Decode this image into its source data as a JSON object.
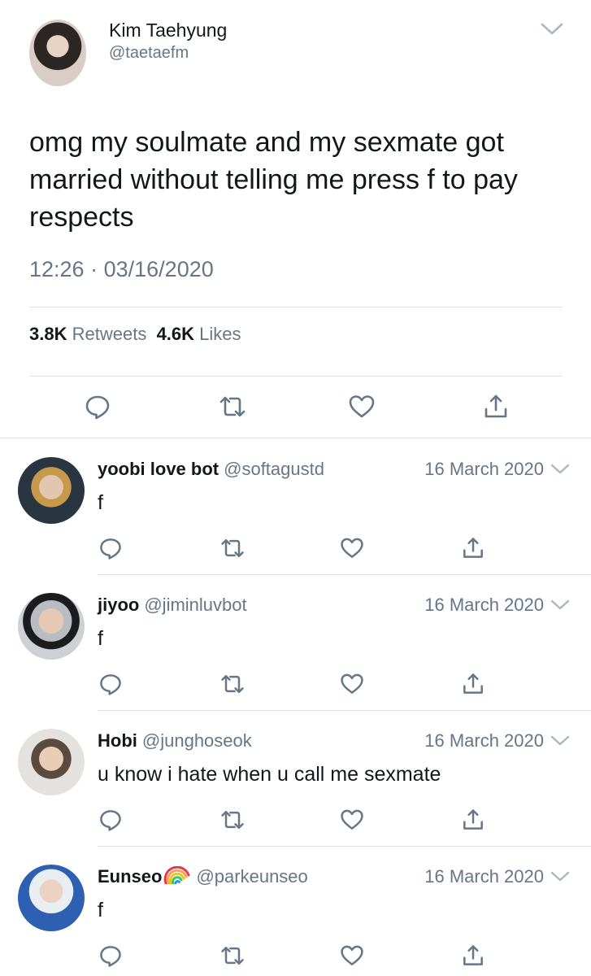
{
  "main_tweet": {
    "author_name": "Kim Taehyung",
    "author_handle": "@taetaefm",
    "text": "omg my soulmate and my sexmate got married without telling me press f to pay respects",
    "time": "12:26",
    "separator": "·",
    "date": "03/16/2020",
    "retweets_count": "3.8K",
    "retweets_label": "Retweets",
    "likes_count": "4.6K",
    "likes_label": "Likes"
  },
  "replies": [
    {
      "name": "yoobi love bot",
      "handle": "@softagustd",
      "date": "16 March 2020",
      "text": "f",
      "emoji": ""
    },
    {
      "name": "jiyoo",
      "handle": "@jiminluvbot",
      "date": "16 March 2020",
      "text": "f",
      "emoji": ""
    },
    {
      "name": "Hobi",
      "handle": "@junghoseok",
      "date": "16 March 2020",
      "text": "u know i hate when u call me sexmate",
      "emoji": ""
    },
    {
      "name": "Eunseo",
      "handle": "@parkeunseo",
      "date": "16 March 2020",
      "text": "f",
      "emoji": "rainbow-icon"
    }
  ],
  "colors": {
    "text": "#14171a",
    "secondary": "#657786",
    "divider": "#dfe3e7",
    "icon": "#657786"
  },
  "icons": [
    "chevron-down-icon",
    "reply-icon",
    "retweet-icon",
    "like-icon",
    "share-icon",
    "rainbow-icon"
  ]
}
